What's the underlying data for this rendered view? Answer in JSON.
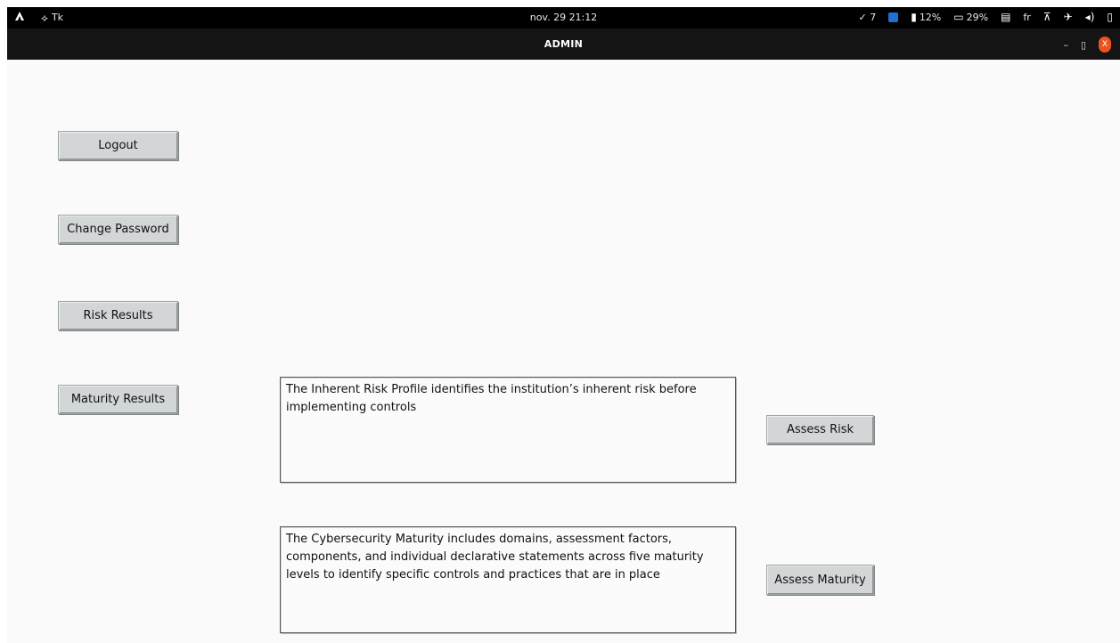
{
  "system_bar": {
    "app_name": "Tk",
    "clock": "nov. 29 21:12",
    "tasks": "✓ 7",
    "battery1": "12%",
    "battery2": "29%",
    "language": "fr"
  },
  "window": {
    "title": "ADMIN",
    "minimize": "–",
    "restore": "▯",
    "close": "X"
  },
  "buttons": {
    "logout": "Logout",
    "change_password": "Change Password",
    "risk_results": "Risk Results",
    "maturity_results": "Maturity Results",
    "assess_risk": "Assess Risk",
    "assess_maturity": "Assess Maturity"
  },
  "descriptions": {
    "risk": "The Inherent Risk Profile identifies the institution’s inherent risk before implementing controls",
    "maturity": "The Cybersecurity Maturity includes domains, assessment factors, components, and individual declarative statements across five maturity levels to identify specific controls and practices that are in place"
  }
}
